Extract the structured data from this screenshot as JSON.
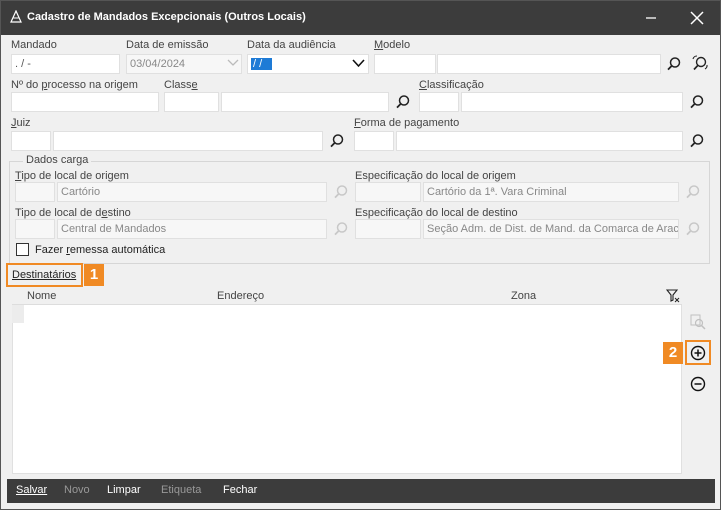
{
  "window": {
    "title": "Cadastro de Mandados Excepcionais (Outros Locais)"
  },
  "fields": {
    "mandado": {
      "label": "Mandado",
      "value": ".  /    -"
    },
    "data_emissao": {
      "label": "Data de emissão",
      "value": "03/04/2024"
    },
    "data_audiencia": {
      "label": "Data da audiência",
      "value": " / /"
    },
    "modelo": {
      "label": "Modelo",
      "value": ""
    },
    "processo_origem": {
      "label": "Nº do processo na origem",
      "value": ""
    },
    "classe": {
      "label": "Classe",
      "value": ""
    },
    "classificacao": {
      "label": "Classificação",
      "value": ""
    },
    "juiz": {
      "label": "Juiz",
      "value": ""
    },
    "forma_pagamento": {
      "label": "Forma de pagamento",
      "value": ""
    }
  },
  "dados_carga": {
    "title": "Dados carga",
    "tipo_local_origem": {
      "label": "Tipo de local de origem",
      "value": "Cartório"
    },
    "especificacao_origem": {
      "label": "Especificação do local de origem",
      "value": "Cartório da 1ª. Vara Criminal"
    },
    "tipo_local_destino": {
      "label": "Tipo de local de destino",
      "value": "Central de Mandados"
    },
    "especificacao_destino": {
      "label": "Especificação do local de destino",
      "value": "Seção Adm. de Dist. de Mand. da Comarca de Arac"
    },
    "remessa_automatica": {
      "label": "Fazer remessa automática",
      "checked": false
    }
  },
  "destinatarios": {
    "title": "Destinatários",
    "columns": [
      "Nome",
      "Endereço",
      "Zona"
    ]
  },
  "callouts": {
    "one": "1",
    "two": "2"
  },
  "bottom_buttons": [
    {
      "label": "Salvar",
      "enabled": true
    },
    {
      "label": "Novo",
      "enabled": false
    },
    {
      "label": "Limpar",
      "enabled": true
    },
    {
      "label": "Etiqueta",
      "enabled": false
    },
    {
      "label": "Fechar",
      "enabled": true
    }
  ],
  "colors": {
    "titlebar": "#3c3c3c",
    "accent_callout": "#f08a24",
    "selected_date_bg": "#1e7bd6"
  },
  "icons": [
    "search-icon",
    "app-icon",
    "filter-icon",
    "zoom-icon",
    "add-icon",
    "remove-icon",
    "refresh-search-icon"
  ]
}
